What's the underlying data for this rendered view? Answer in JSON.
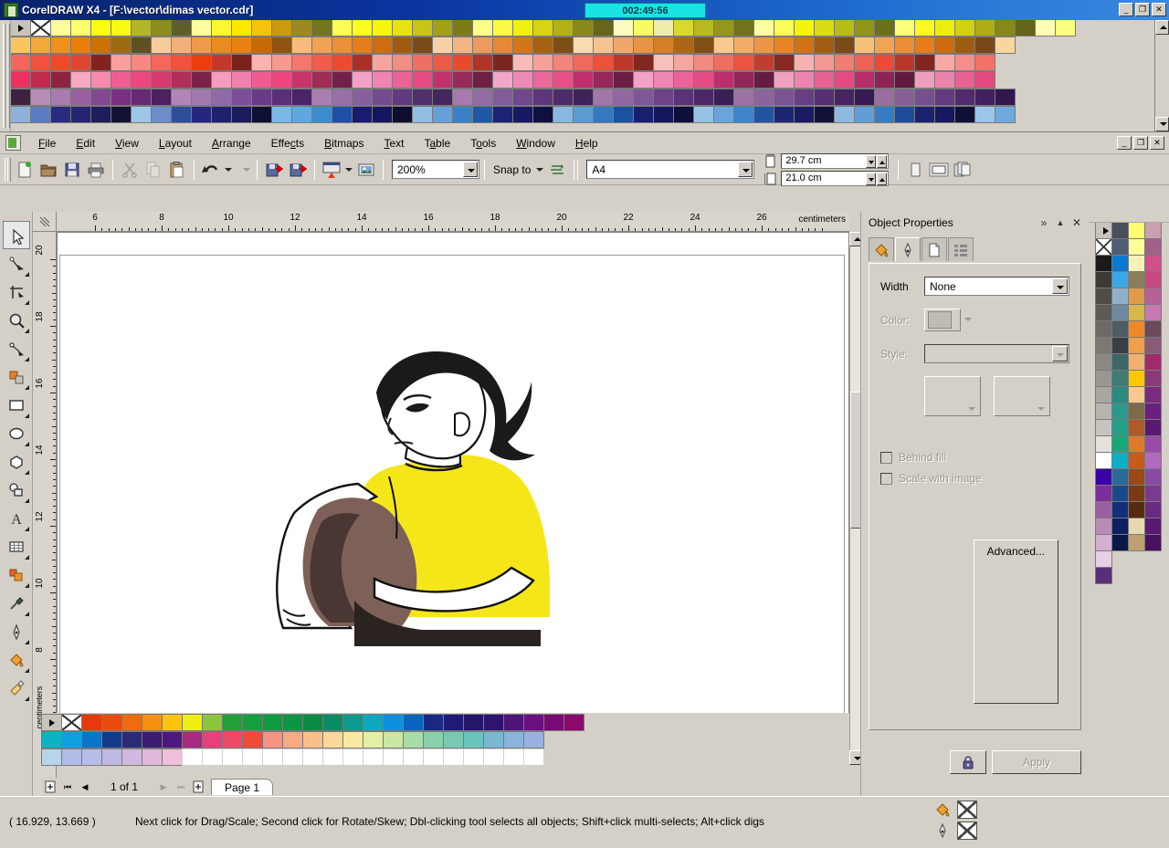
{
  "window": {
    "title": "CorelDRAW X4 - [F:\\vector\\dimas vector.cdr]",
    "timer": "002:49:56",
    "minimize": "_",
    "restore": "❐",
    "close": "✕"
  },
  "mdi": {
    "minimize": "_",
    "restore": "❐",
    "close": "✕"
  },
  "menu": {
    "items": [
      {
        "label": "File",
        "mnemonic": "F"
      },
      {
        "label": "Edit",
        "mnemonic": "E"
      },
      {
        "label": "View",
        "mnemonic": "V"
      },
      {
        "label": "Layout",
        "mnemonic": "L"
      },
      {
        "label": "Arrange",
        "mnemonic": "A"
      },
      {
        "label": "Effects",
        "mnemonic": "c"
      },
      {
        "label": "Bitmaps",
        "mnemonic": "B"
      },
      {
        "label": "Text",
        "mnemonic": "T"
      },
      {
        "label": "Table",
        "mnemonic": "a"
      },
      {
        "label": "Tools",
        "mnemonic": "o"
      },
      {
        "label": "Window",
        "mnemonic": "W"
      },
      {
        "label": "Help",
        "mnemonic": "H"
      }
    ]
  },
  "toolbar": {
    "new": "new-document",
    "open": "open-folder",
    "save": "save-disk",
    "print": "printer",
    "cut": "cut-scissors",
    "copy": "copy-pages",
    "paste": "paste-clipboard",
    "undo": "undo-arrow",
    "redo": "redo-arrow",
    "import": "import-file",
    "export": "export-file",
    "app_launcher": "application-launcher",
    "corel_connect": "corel-connect",
    "zoom_level": "200%",
    "snap_to_label": "Snap to",
    "snap_icon": "snap-options",
    "paper_type": "A4",
    "page_width": "29.7 cm",
    "page_height": "21.0 cm",
    "orientation_portrait": "portrait-icon",
    "orientation_landscape": "landscape-icon",
    "page_options": "page-options-icon"
  },
  "toolbox": {
    "tools": [
      {
        "name": "pick-tool",
        "active": true
      },
      {
        "name": "shape-tool",
        "active": false
      },
      {
        "name": "crop-tool",
        "active": false
      },
      {
        "name": "zoom-tool",
        "active": false
      },
      {
        "name": "freehand-tool",
        "active": false
      },
      {
        "name": "smart-fill-tool",
        "active": false
      },
      {
        "name": "rectangle-tool",
        "active": false
      },
      {
        "name": "ellipse-tool",
        "active": false
      },
      {
        "name": "polygon-tool",
        "active": false
      },
      {
        "name": "blend-tool",
        "active": false
      },
      {
        "name": "text-tool",
        "active": false
      },
      {
        "name": "table-tool",
        "active": false
      },
      {
        "name": "interactive-fill-tool",
        "active": false
      },
      {
        "name": "eyedropper-tool",
        "active": false
      },
      {
        "name": "outline-tool",
        "active": false
      },
      {
        "name": "fill-tool",
        "active": false
      },
      {
        "name": "paint-tool",
        "active": false
      }
    ]
  },
  "rulers": {
    "unit": "centimeters",
    "horizontal_labels": [
      "6",
      "8",
      "10",
      "12",
      "14",
      "16",
      "18",
      "20",
      "22",
      "24",
      "26"
    ],
    "vertical_labels": [
      "20",
      "18",
      "16",
      "14",
      "12",
      "10",
      "8"
    ]
  },
  "page_navigator": {
    "add_page_start": "add-page-icon",
    "first": "⏮",
    "prev": "◀",
    "counter": "1 of 1",
    "next": "▶",
    "last": "⏭",
    "add_page_end": "add-page-icon",
    "tab_label": "Page 1"
  },
  "docker": {
    "title": "Object Properties",
    "expand_icon": "»",
    "collapse_icon": "▲",
    "close_icon": "✕",
    "tabs": [
      {
        "name": "fill-tab",
        "icon": "paint-bucket-icon",
        "active": false
      },
      {
        "name": "outline-tab",
        "icon": "pen-nib-icon",
        "active": true
      },
      {
        "name": "general-tab",
        "icon": "document-icon",
        "active": false
      },
      {
        "name": "details-tab",
        "icon": "list-icon",
        "active": false
      }
    ],
    "width_label": "Width",
    "width_value": "None",
    "color_label": "Color:",
    "style_label": "Style:",
    "behind_fill_label": "Behind fill",
    "scale_with_image_label": "Scale with image",
    "advanced_label": "Advanced...",
    "lock_icon": "lock-icon",
    "apply_label": "Apply"
  },
  "status": {
    "coordinates": "( 16.929, 13.669 )",
    "hint": "Next click for Drag/Scale; Second click for Rotate/Skew; Dbl-clicking tool selects all objects; Shift+click multi-selects; Alt+click digs",
    "fill_icon": "fill-bucket-icon",
    "outline_icon": "outline-pen-icon",
    "fill_value": "none",
    "outline_value": "none"
  },
  "artwork": {
    "description": "Vector illustration of a seated young man with dark spiky hair wearing a yellow t-shirt, arms wrapped around a ball",
    "colors": {
      "hair": "#1a1a1a",
      "shirt": "#f5e61a",
      "ball": "#7d6058",
      "ball_shadow": "#4a3632",
      "skin": "#ffffff",
      "pants": "#2b2320",
      "outline": "#000000"
    }
  },
  "palettes": {
    "top": {
      "arrow_swatch": "palette-scroll-arrow",
      "none_swatch": "no-color",
      "rows": [
        [
          "#fdfd9a",
          "#fdfd70",
          "#fcfc10",
          "#f9f915",
          "#b5b52a",
          "#8d8d20",
          "#5e5e2a",
          "#fdfd9f",
          "#fdf830",
          "#ffe800",
          "#f7c40d",
          "#cc9a10",
          "#9b8a22",
          "#71761f",
          "#fdfd55",
          "#fefe20",
          "#f6f60e",
          "#e8e30f",
          "#c8c418",
          "#a2a016",
          "#7c7c17",
          "#fdfd88",
          "#fbfb44",
          "#f0f012",
          "#d8d414",
          "#b4b018",
          "#8a881a",
          "#66661a",
          "#fcfcc0",
          "#fafa66",
          "#ededaa",
          "#d9d930",
          "#b9b920",
          "#96961d",
          "#72721c",
          "#fdfda0",
          "#fcfc5a",
          "#f4f40f",
          "#dadc14",
          "#b8bc17",
          "#919518",
          "#6c7018",
          "#fdfd7a",
          "#fafa22",
          "#eeee0e",
          "#d2d210",
          "#aeae14",
          "#888818",
          "#65651a",
          "#fdfdb4",
          "#fcfc80"
        ],
        [
          "#f9c65e",
          "#f3a838",
          "#f09020",
          "#e97e0e",
          "#cc7106",
          "#9b6b16",
          "#5e5224",
          "#f6cd9a",
          "#f5b079",
          "#f09a4d",
          "#ea8a20",
          "#e88014",
          "#c56a06",
          "#8e5410",
          "#f8bb7e",
          "#f2a159",
          "#ec8e3c",
          "#e57c1d",
          "#cf6c10",
          "#a15a12",
          "#7a4a18",
          "#f7d2a4",
          "#f2b583",
          "#ec9a5e",
          "#e68838",
          "#d2761a",
          "#a66014",
          "#7d4e16",
          "#f9dbb2",
          "#f4c394",
          "#eea86e",
          "#e89448",
          "#d57f26",
          "#ab6618",
          "#804f18",
          "#f8c88e",
          "#f3ad6a",
          "#ed9648",
          "#e78426",
          "#d17216",
          "#a25c14",
          "#7a4a18",
          "#f7c079",
          "#f2a455",
          "#ec8e38",
          "#e67c1c",
          "#cc6c10",
          "#9e5c12",
          "#78481a",
          "#f9d69e"
        ],
        [
          "#f4655c",
          "#f1513d",
          "#ef4a28",
          "#de4631",
          "#84231c",
          "#f99f9e",
          "#f78882",
          "#f4685c",
          "#f2513e",
          "#ed3c0e",
          "#c3382c",
          "#7a231c",
          "#f9b4b2",
          "#f79891",
          "#f4766c",
          "#f15c4c",
          "#ee4a30",
          "#a83026",
          "#f5a59d",
          "#f28d82",
          "#ef7063",
          "#ec5a48",
          "#e84a2e",
          "#b03428",
          "#7d2620",
          "#f8bab6",
          "#f5a199",
          "#f2847a",
          "#ef6a5c",
          "#ec5238",
          "#bb3a2c",
          "#822820",
          "#f7c0bc",
          "#f4a6a0",
          "#f18a80",
          "#ee6e60",
          "#ea5440",
          "#c03e30",
          "#862a22",
          "#f6b2ae",
          "#f39892",
          "#f07c72",
          "#ed6254",
          "#ea4a36",
          "#b8362a",
          "#80261e",
          "#f8a8a4",
          "#f58e88",
          "#f27268"
        ],
        [
          "#ee3060",
          "#c42a4e",
          "#8e2340",
          "#f9a8c0",
          "#f48ab0",
          "#ef5e92",
          "#ec4880",
          "#d43a6e",
          "#b02e5a",
          "#7a2248",
          "#f69cc0",
          "#f280ae",
          "#ee5c92",
          "#eb4680",
          "#c8346a",
          "#a02c56",
          "#72204a",
          "#f4a0c4",
          "#f084b2",
          "#ec6298",
          "#e84a84",
          "#c4326c",
          "#9a2a58",
          "#6e2046",
          "#f3a6c8",
          "#ef8ab6",
          "#eb689c",
          "#e75088",
          "#c0306e",
          "#96285a",
          "#6a1e44",
          "#f2a2c6",
          "#ee86b4",
          "#ea649a",
          "#e64c86",
          "#bc2e6c",
          "#922658",
          "#661c42",
          "#f1a0c2",
          "#ed84b0",
          "#e96296",
          "#e54a82",
          "#b82c6a",
          "#8e2456",
          "#621a40",
          "#f09ec0",
          "#ec82ae",
          "#e86094",
          "#e44880"
        ],
        [
          "#402240",
          "#b98cb8",
          "#a87cae",
          "#9a5fa0",
          "#84488e",
          "#7a2f82",
          "#662a74",
          "#4e2060",
          "#b285b6",
          "#a07aae",
          "#8e6aa6",
          "#7c4e98",
          "#6a3a88",
          "#5a2e78",
          "#4a2468",
          "#aa7eb0",
          "#9870a8",
          "#86609e",
          "#744a90",
          "#623a80",
          "#52306e",
          "#42265e",
          "#a67aac",
          "#946ca4",
          "#825c9a",
          "#70468c",
          "#5e367c",
          "#4e2c6a",
          "#3e225a",
          "#a276a8",
          "#9068a0",
          "#7e5896",
          "#6c4288",
          "#5a3278",
          "#4a2866",
          "#3a1e56",
          "#9e72a4",
          "#8c649c",
          "#7a5492",
          "#683e84",
          "#562e74",
          "#462462",
          "#361a52",
          "#9a6ea0",
          "#886098",
          "#76508e",
          "#643a80",
          "#522a70",
          "#42205e",
          "#321650"
        ],
        [
          "#8fb0dc",
          "#5b7cc0",
          "#2a2a80",
          "#242470",
          "#1e1e5c",
          "#121230",
          "#9ec6e8",
          "#6e8cc8",
          "#2e4e9c",
          "#262680",
          "#202070",
          "#1a1a5c",
          "#101030",
          "#7ab8e8",
          "#5ea8e0",
          "#3c8cd0",
          "#1e4ea8",
          "#1a1a70",
          "#161660",
          "#0e0e2c",
          "#92bee4",
          "#66a0d8",
          "#3a80c8",
          "#2058a8",
          "#1c2278",
          "#181866",
          "#101040",
          "#88b8e0",
          "#5c9cd4",
          "#3478c0",
          "#1c50a0",
          "#1a1e70",
          "#161660",
          "#0e0e38",
          "#96c2e6",
          "#6aa4da",
          "#3e84ca",
          "#2254a4",
          "#1e2674",
          "#1a1a64",
          "#121238",
          "#8ebae2",
          "#629ed6",
          "#367cc4",
          "#1e4c9c",
          "#1c2270",
          "#181860",
          "#101034",
          "#9ac6ea",
          "#6ea8dc"
        ]
      ]
    },
    "right": {
      "arrow_swatch": "palette-scroll-arrow",
      "none_swatch": "no-color",
      "columns": [
        [
          "#1c1a18",
          "#3d3a36",
          "#4f4c48",
          "#5e5b57",
          "#6d6a66",
          "#7c7975",
          "#8b8884",
          "#9a9793",
          "#a9a6a2",
          "#b8b5b1",
          "#c7c4c0",
          "#e5e2de",
          "#ffffff",
          "#3a00a8",
          "#7a2f9a",
          "#9a5fa0",
          "#b98cb8",
          "#d4b0d0",
          "#e8d0e4",
          "#5a2e78"
        ],
        [
          "#4a4e5c",
          "#4e5c74",
          "#0a7ad0",
          "#3aa8e8",
          "#8fb0cc",
          "#6e8aa0",
          "#4e5c64",
          "#3a3e44",
          "#3e6668",
          "#3e7c74",
          "#2a8a80",
          "#2a9a8c",
          "#22a088",
          "#18a878",
          "#0ab0c8",
          "#2a6a9a",
          "#1a4a8a",
          "#12307a",
          "#0e2060",
          "#0a1848"
        ],
        [
          "#fdfd70",
          "#fdfd9a",
          "#f6f2b8",
          "#8a7e5a",
          "#e09a4a",
          "#d8b84a",
          "#f08828",
          "#f0a048",
          "#f2b070",
          "#ffc800",
          "#f8c890",
          "#7d6a4a",
          "#b05a2a",
          "#e07a2a",
          "#c85a1a",
          "#9a4a18",
          "#7a3a14",
          "#5a2a10",
          "#e8d8b0",
          "#c0a070"
        ],
        [
          "#c8a0b0",
          "#a06088",
          "#d0508c",
          "#c84880",
          "#b86098",
          "#c878b0",
          "#6a4a5c",
          "#8a5a78",
          "#a02a6c",
          "#8a3a78",
          "#7a2a80",
          "#6a2080",
          "#5a1a70",
          "#9a4aa8",
          "#b06ac0",
          "#8a4aa0",
          "#7a3a90",
          "#6a2a80",
          "#5a1a70",
          "#4a1060"
        ]
      ]
    },
    "bottom": {
      "arrow_swatch": "palette-scroll-arrow",
      "none_swatch": "no-color",
      "rows": [
        [
          "#e8380d",
          "#ec4a0e",
          "#f06a10",
          "#f59010",
          "#fcc40a",
          "#eeee10",
          "#8cc63f",
          "#21a03a",
          "#14a03c",
          "#109a40",
          "#0d9444",
          "#0b8a46",
          "#0a8c64",
          "#0c9a8c",
          "#0ca8c0",
          "#0e90e0",
          "#0a64c0",
          "#1a2a84",
          "#201a76",
          "#26166a",
          "#2c1470",
          "#4e1478",
          "#6a1080",
          "#7a0a74",
          "#8a0a6a"
        ],
        [
          "#0cb4c0",
          "#0ea0e0",
          "#0a74c8",
          "#123a8a",
          "#2a2a76",
          "#3a1c72",
          "#4e1880",
          "#a82a80",
          "#e8407c",
          "#ee4a68",
          "#f24a38",
          "#f59282",
          "#f7aa84",
          "#f9c08a",
          "#fad89a",
          "#faeaa0",
          "#e4eea4",
          "#c8e8a4",
          "#a8dca8",
          "#8ad0aa",
          "#7ac8b4",
          "#6ac4be",
          "#7ab8d0",
          "#8ab4dc",
          "#9ab0e0"
        ],
        [
          "#b8d4e8",
          "#b0bce4",
          "#b8bce8",
          "#c0b8e4",
          "#d0b8e0",
          "#e0b8dc",
          "#f0c0d8",
          "#ffffff",
          "#ffffff",
          "#ffffff",
          "#ffffff",
          "#ffffff",
          "#ffffff",
          "#ffffff",
          "#ffffff",
          "#ffffff",
          "#ffffff",
          "#ffffff",
          "#ffffff",
          "#ffffff",
          "#ffffff",
          "#ffffff",
          "#ffffff",
          "#ffffff",
          "#ffffff"
        ]
      ]
    }
  }
}
